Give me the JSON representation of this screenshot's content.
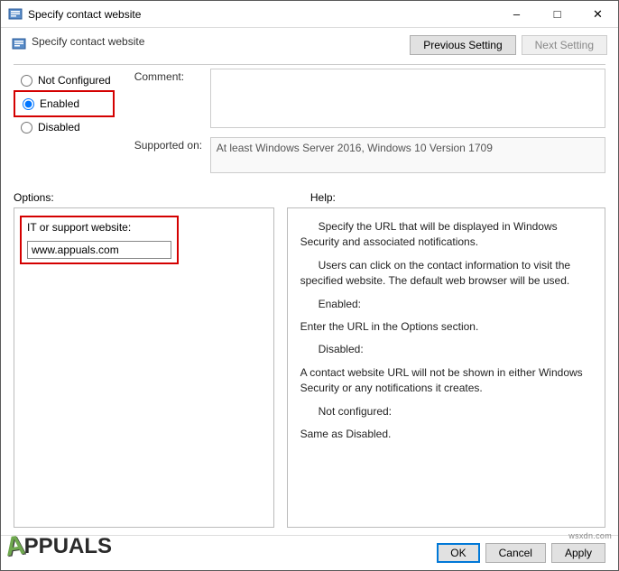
{
  "window": {
    "title": "Specify contact website",
    "policy_title": "Specify contact website"
  },
  "nav": {
    "previous": "Previous Setting",
    "next": "Next Setting"
  },
  "state": {
    "not_configured": "Not Configured",
    "enabled": "Enabled",
    "disabled": "Disabled"
  },
  "labels": {
    "comment": "Comment:",
    "supported_on": "Supported on:",
    "options": "Options:",
    "help": "Help:",
    "option_field": "IT or support website:"
  },
  "values": {
    "supported": "At least Windows Server 2016, Windows 10 Version 1709",
    "website": "www.appuals.com",
    "comment": ""
  },
  "help": {
    "p1": "Specify the URL that will be displayed in Windows Security and associated notifications.",
    "p2": "Users can click on the contact information to visit the specified website. The default web browser will be used.",
    "p3a": "Enabled:",
    "p3b": "Enter the URL in the Options section.",
    "p4a": "Disabled:",
    "p4b": "A contact website URL will not be shown in either Windows Security or any notifications it creates.",
    "p5a": "Not configured:",
    "p5b": "Same as Disabled."
  },
  "footer": {
    "ok": "OK",
    "cancel": "Cancel",
    "apply": "Apply"
  },
  "watermark": {
    "brand_tail": "PPUALS",
    "side": "wsxdn.com"
  }
}
